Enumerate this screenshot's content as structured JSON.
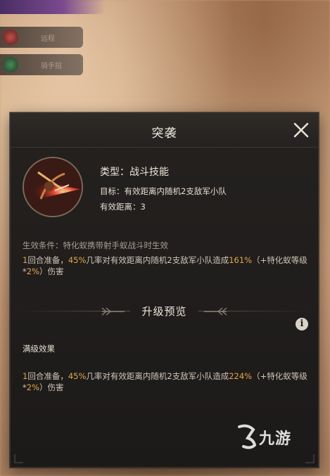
{
  "background": {
    "buttons": [
      {
        "label": "远程"
      },
      {
        "label": "骑手招"
      }
    ]
  },
  "dialog": {
    "title": "突袭",
    "skill": {
      "type_line": "类型：战斗技能",
      "target_line": "目标：有效距离内随机2支敌军小队",
      "range_line": "有效距离：3"
    },
    "condition": "生效条件：特化蚁携带射手蚁战斗时生效",
    "effect": {
      "part1_num": "1",
      "part1_text": "回合准备，",
      "part2_num": "45%",
      "part2_text": "几率对有效距离内随机2支敌军小队造成",
      "part3_num": "161%",
      "part3_text": "（+特化蚁等级*",
      "part4_num": "2%",
      "part4_text": "）伤害"
    },
    "upgrade_title": "升级预览",
    "info_icon": "i",
    "max_label": "满级效果",
    "max_effect": {
      "part1_num": "1",
      "part1_text": "回合准备，",
      "part2_num": "45%",
      "part2_text": "几率对有效距离内随机2支敌军小队造成",
      "part3_num": "224%",
      "part3_text": "（+特化蚁等级*",
      "part4_num": "2%",
      "part4_text": "）伤害"
    }
  },
  "watermark": {
    "text": "九游"
  },
  "colors": {
    "highlight": "#e0a84a",
    "panel": "#1f1c1b",
    "text": "#e5ddd2"
  }
}
